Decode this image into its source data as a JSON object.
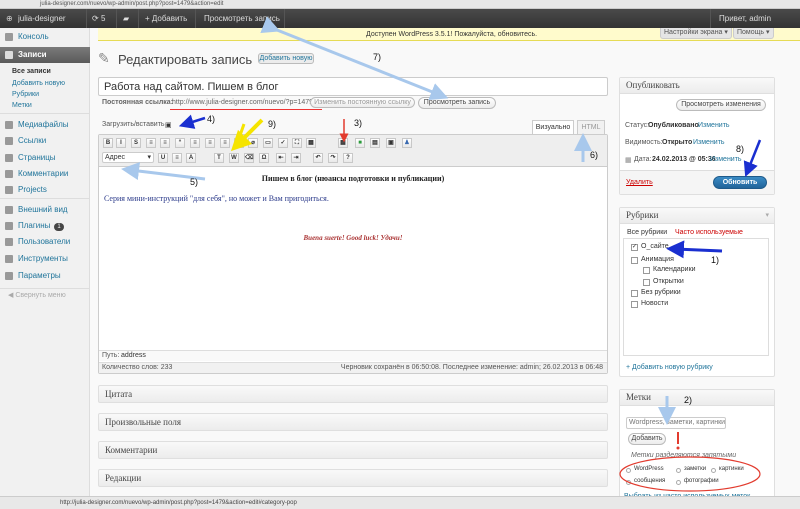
{
  "browser": {
    "url": "julia-designer.com/nuevo/wp-admin/post.php?post=1479&action=edit",
    "status_url": "http://julia-designer.com/nuevo/wp-admin/post.php?post=1479&action=edit#category-pop"
  },
  "adminbar": {
    "site_name": "julia-designer",
    "updates_count": "5",
    "add_label": "Добавить",
    "view_post_label": "Просмотреть запись",
    "greeting": "Привет, admin"
  },
  "sidebar": {
    "items": [
      {
        "label": "Консоль",
        "icon": "dashboard-icon"
      },
      {
        "label": "Записи",
        "icon": "pin-icon"
      },
      {
        "label": "Медиафайлы",
        "icon": "media-icon"
      },
      {
        "label": "Ссылки",
        "icon": "link-icon"
      },
      {
        "label": "Страницы",
        "icon": "page-icon"
      },
      {
        "label": "Комментарии",
        "icon": "comment-icon"
      },
      {
        "label": "Projects",
        "icon": "projects-icon"
      },
      {
        "label": "Внешний вид",
        "icon": "appearance-icon"
      },
      {
        "label": "Плагины",
        "icon": "plugin-icon",
        "badge": "1"
      },
      {
        "label": "Пользователи",
        "icon": "users-icon"
      },
      {
        "label": "Инструменты",
        "icon": "tools-icon"
      },
      {
        "label": "Параметры",
        "icon": "settings-icon"
      }
    ],
    "submenu": [
      "Все записи",
      "Добавить новую",
      "Рубрики",
      "Метки"
    ],
    "collapse_label": "Свернуть меню"
  },
  "notice": {
    "text": "Доступен WordPress 3.5.1! Пожалуйста, обновитесь.",
    "screen_options": "Настройки экрана",
    "help": "Помощь"
  },
  "page": {
    "title": "Редактировать запись",
    "add_new": "Добавить новую"
  },
  "post": {
    "title": "Работа над сайтом. Пишем в блог",
    "permalink_label": "Постоянная ссылка:",
    "permalink_url": "http://www.julia-designer.com/nuevo/?p=1479",
    "permalink_hint": "Изменить постоянную ссылку",
    "view_button": "Просмотреть запись"
  },
  "editor": {
    "upload_label": "Загрузить/вставить",
    "tab_visual": "Визуально",
    "tab_html": "HTML",
    "format_select": "Адрес",
    "heading": "Пишем в блог (нюансы подготовки и публикации)",
    "body_text": "Серия мини-инструкций \"для себя\", но может и Вам пригодиться.",
    "footer_text": "Buena suerte! Good luck! Удачи!",
    "path_label": "Путь:",
    "path_value": "address",
    "word_count": "Количество слов: 233",
    "draft_saved": "Черновик сохранён в 06:50:08. Последнее изменение: admin; 26.02.2013 в 06:48"
  },
  "metaboxes": [
    "Цитата",
    "Произвольные поля",
    "Комментарии",
    "Редакции"
  ],
  "publish": {
    "title": "Опубликовать",
    "preview_button": "Просмотреть изменения",
    "status_label": "Статус:",
    "status_value": "Опубликовано",
    "visibility_label": "Видимость:",
    "visibility_value": "Открыто",
    "date_label": "Дата:",
    "date_value": "24.02.2013 @ 05:36",
    "edit_link": "Изменить",
    "delete_link": "Удалить",
    "update_button": "Обновить"
  },
  "categories": {
    "title": "Рубрики",
    "tab_all": "Все рубрики",
    "tab_popular": "Часто используемые",
    "items": [
      {
        "label": "О_сайте",
        "checked": true,
        "indent": false
      },
      {
        "label": "Анимация",
        "checked": false,
        "indent": false
      },
      {
        "label": "Календарики",
        "checked": false,
        "indent": true
      },
      {
        "label": "Открытки",
        "checked": false,
        "indent": true
      },
      {
        "label": "Без рубрики",
        "checked": false,
        "indent": false
      },
      {
        "label": "Новости",
        "checked": false,
        "indent": false
      }
    ],
    "add_link": "+ Добавить новую рубрику"
  },
  "tags": {
    "title": "Метки",
    "placeholder": "Wordpress, заметки, картинки",
    "add_button": "Добавить",
    "hint": "Метки разделяются запятыми",
    "examples": [
      "WordPress",
      "заметки",
      "картинки",
      "сообщения",
      "фотографии"
    ],
    "choose_link": "Выбрать из часто используемых меток"
  },
  "annotations": [
    "1)",
    "2)",
    "3)",
    "4)",
    "5)",
    "6)",
    "7)",
    "8)",
    "9)"
  ],
  "colors": {
    "annotation_blue": "#1a2fd0",
    "annotation_light_blue": "#a8c8ec",
    "annotation_red": "#e23b2e",
    "annotation_yellow": "#f5e400",
    "adminbar": "#464646",
    "link": "#21759b",
    "update_button": "#2a6f9e"
  }
}
